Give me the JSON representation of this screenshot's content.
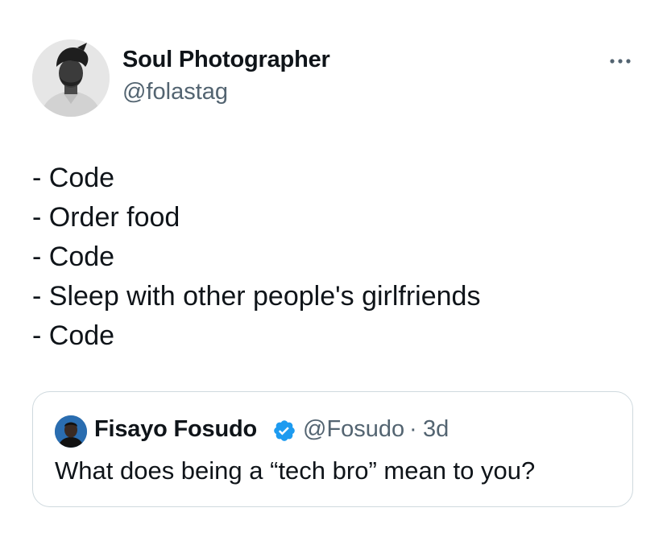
{
  "tweet": {
    "author": {
      "display_name": "Soul Photographer",
      "handle": "@folastag",
      "avatar_icon": "profile-photo"
    },
    "more_icon": "more-horizontal-icon",
    "lines": [
      "- Code",
      "- Order food",
      "- Code",
      "- Sleep with other people's girlfriends",
      "- Code"
    ]
  },
  "quoted_tweet": {
    "author": {
      "display_name": "Fisayo Fosudo",
      "verified_icon": "verified-badge-icon",
      "handle": "@Fosudo",
      "separator": "·",
      "time": "3d"
    },
    "text": "What does being a “tech bro” mean to you?"
  },
  "colors": {
    "text_primary": "#0f1419",
    "text_secondary": "#536471",
    "border": "#cfd9de",
    "verified_blue": "#1d9bf0"
  }
}
